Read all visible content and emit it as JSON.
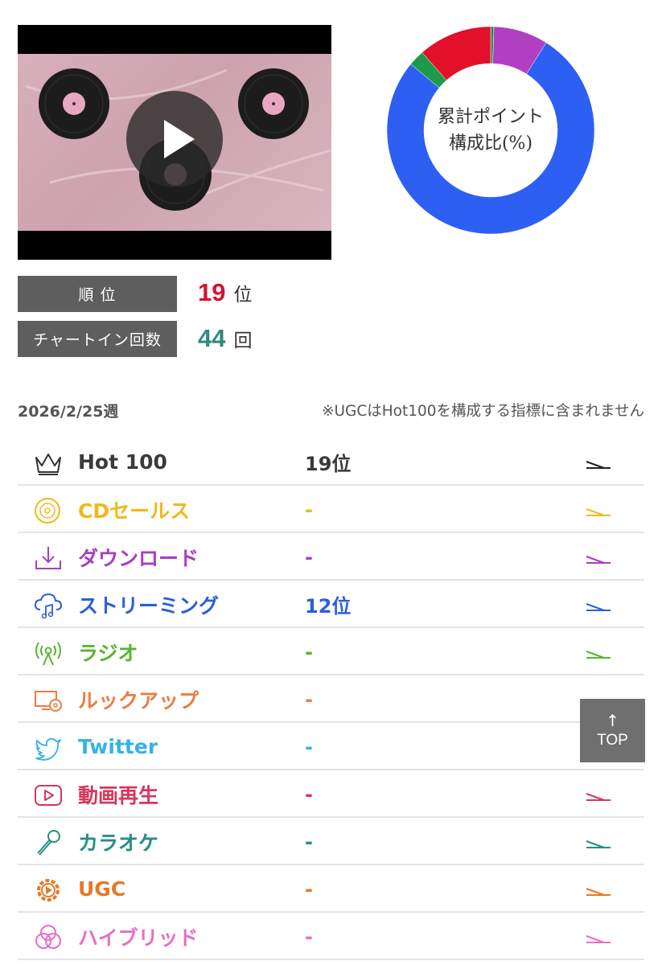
{
  "donut": {
    "center_line1": "累計ポイント",
    "center_line2": "構成比(%)",
    "segments": [
      {
        "percent": 0.5,
        "color": "#2e8b57"
      },
      {
        "percent": 8.5,
        "color": "#b03fc2"
      },
      {
        "percent": 77.0,
        "color": "#2d5ff3"
      },
      {
        "percent": 2.5,
        "color": "#1d9a4a"
      },
      {
        "percent": 11.5,
        "color": "#e3102a"
      }
    ]
  },
  "stats": {
    "rank_label": "順 位",
    "rank_value": "19",
    "rank_unit": "位",
    "chartin_label": "チャートイン回数",
    "chartin_value": "44",
    "chartin_unit": "回"
  },
  "week": "2026/2/25週",
  "note": "※UGCはHot100を構成する指標に含まれません",
  "rows": [
    {
      "name": "Hot 100",
      "rank": "19位",
      "color": "#3a3a3a",
      "icon": "crown-icon"
    },
    {
      "name": "CDセールス",
      "rank": "-",
      "color": "#f1b71c",
      "icon": "cd-icon"
    },
    {
      "name": "ダウンロード",
      "rank": "-",
      "color": "#a93fbf",
      "icon": "download-icon"
    },
    {
      "name": "ストリーミング",
      "rank": "12位",
      "color": "#2c5fd6",
      "icon": "cloud-music-icon"
    },
    {
      "name": "ラジオ",
      "rank": "-",
      "color": "#58b531",
      "icon": "radio-icon"
    },
    {
      "name": "ルックアップ",
      "rank": "-",
      "color": "#ec7d42",
      "icon": "lookup-icon"
    },
    {
      "name": "Twitter",
      "rank": "-",
      "color": "#35b3e3",
      "icon": "twitter-icon"
    },
    {
      "name": "動画再生",
      "rank": "-",
      "color": "#d7365d",
      "icon": "video-play-icon"
    },
    {
      "name": "カラオケ",
      "rank": "-",
      "color": "#268f80",
      "icon": "microphone-icon"
    },
    {
      "name": "UGC",
      "rank": "-",
      "color": "#e47a28",
      "icon": "ugc-icon"
    },
    {
      "name": "ハイブリッド",
      "rank": "-",
      "color": "#e86ec7",
      "icon": "hybrid-icon"
    }
  ],
  "top_button": {
    "arrow": "↑",
    "label": "TOP"
  }
}
